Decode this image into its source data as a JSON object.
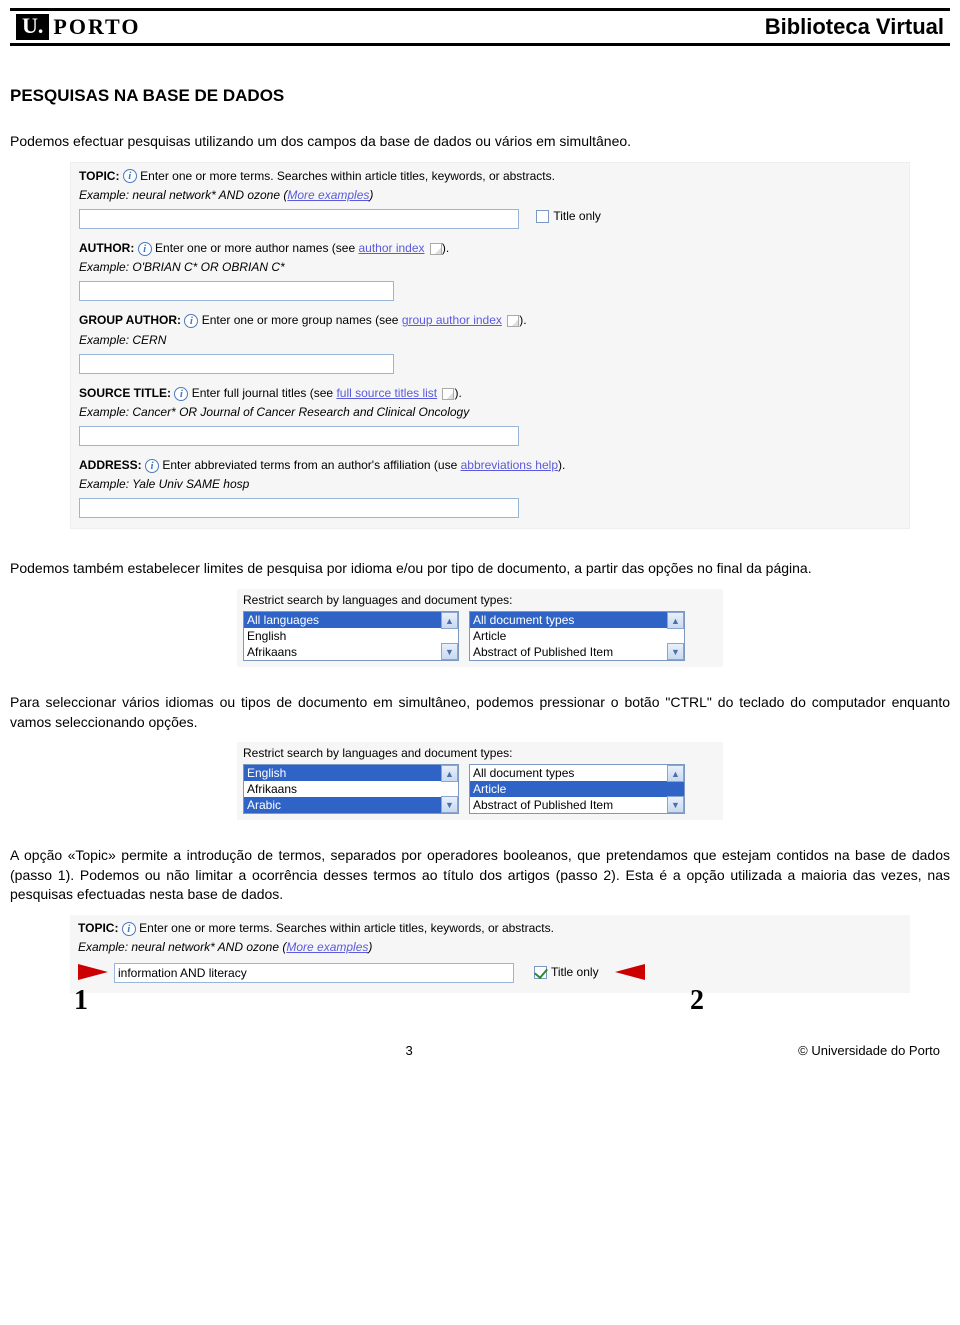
{
  "header": {
    "logo_u": "U.",
    "logo_text": "PORTO",
    "site_title": "Biblioteca Virtual"
  },
  "section_title": "PESQUISAS NA BASE DE DADOS",
  "intro_text": "Podemos efectuar pesquisas utilizando um dos campos da base de dados ou vários em simultâneo.",
  "form": {
    "topic": {
      "label": "TOPIC:",
      "hint": "Enter one or more terms. Searches within article titles, keywords, or abstracts.",
      "example_prefix": "Example:",
      "example": "neural network* AND ozone",
      "more_link": "More examples",
      "title_only": "Title only"
    },
    "author": {
      "label": "AUTHOR:",
      "hint": "Enter one or more author names (see",
      "index_link": "author index",
      "example_prefix": "Example:",
      "example": "O'BRIAN C* OR OBRIAN C*"
    },
    "group_author": {
      "label": "GROUP AUTHOR:",
      "hint": "Enter one or more group names (see",
      "index_link": "group author index",
      "example_prefix": "Example:",
      "example": "CERN"
    },
    "source_title": {
      "label": "SOURCE TITLE:",
      "hint": "Enter full journal titles (see",
      "index_link": "full source titles list",
      "example_prefix": "Example:",
      "example": "Cancer* OR Journal of Cancer Research and Clinical Oncology"
    },
    "address": {
      "label": "ADDRESS:",
      "hint": "Enter abbreviated terms from an author's affiliation (use",
      "index_link": "abbreviations help",
      "example_prefix": "Example:",
      "example": "Yale Univ SAME hosp"
    }
  },
  "after_form_text": "Podemos também estabelecer limites de pesquisa por idioma e/ou por tipo de documento, a partir das opções no final da página.",
  "restrict1": {
    "title": "Restrict search by languages and document types:",
    "langs": [
      "All languages",
      "English",
      "Afrikaans"
    ],
    "langs_selected": [
      0
    ],
    "docs": [
      "All document types",
      "Article",
      "Abstract of Published Item"
    ],
    "docs_selected": [
      0
    ]
  },
  "between_restrict_text": "Para seleccionar vários idiomas ou tipos de documento em simultâneo, podemos pressionar o botão \"CTRL\" do teclado do computador enquanto vamos seleccionando opções.",
  "restrict2": {
    "title": "Restrict search by languages and document types:",
    "langs": [
      "English",
      "Afrikaans",
      "Arabic"
    ],
    "langs_selected": [
      0,
      2
    ],
    "docs": [
      "All document types",
      "Article",
      "Abstract of Published Item"
    ],
    "docs_selected": [
      1
    ]
  },
  "topic_paragraph": "A opção «Topic» permite a introdução de termos, separados por operadores booleanos, que pretendamos que estejam contidos na base de dados (passo 1). Podemos ou não limitar a ocorrência desses termos ao título dos artigos (passo 2). Esta é a opção utilizada a maioria das vezes, nas pesquisas efectuadas nesta base de dados.",
  "topic_demo": {
    "label": "TOPIC:",
    "hint": "Enter one or more terms. Searches within article titles, keywords, or abstracts.",
    "example_prefix": "Example:",
    "example": "neural network* AND ozone",
    "more_link": "More examples",
    "input_value": "information AND literacy",
    "title_only": "Title only",
    "num1": "1",
    "num2": "2"
  },
  "footer": {
    "page": "3",
    "org": "© Universidade do Porto"
  }
}
